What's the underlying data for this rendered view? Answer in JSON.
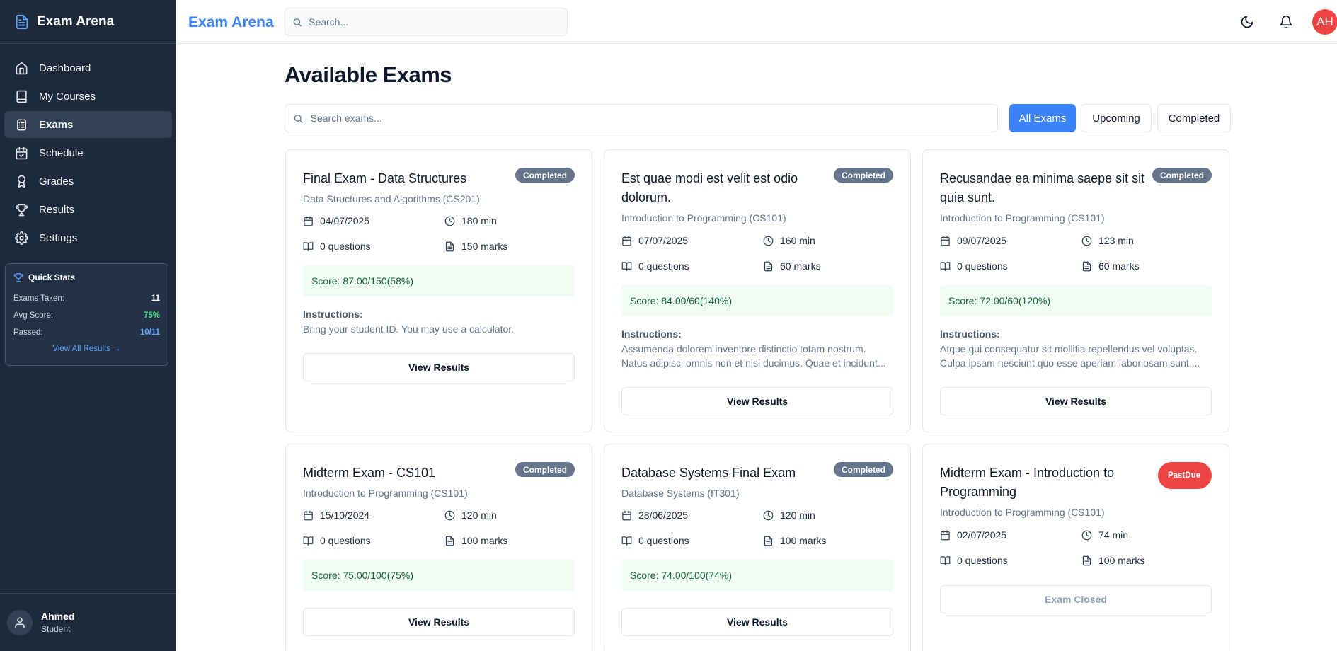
{
  "app": {
    "title": "Exam Arena"
  },
  "sidebar": {
    "items": [
      {
        "label": "Dashboard",
        "icon": "home-icon"
      },
      {
        "label": "My Courses",
        "icon": "book-icon"
      },
      {
        "label": "Exams",
        "icon": "clipboard-icon",
        "active": true
      },
      {
        "label": "Schedule",
        "icon": "calendar-check-icon"
      },
      {
        "label": "Grades",
        "icon": "award-icon"
      },
      {
        "label": "Results",
        "icon": "trophy-icon"
      },
      {
        "label": "Settings",
        "icon": "gear-icon"
      }
    ],
    "quick_stats": {
      "title": "Quick Stats",
      "exams_taken_label": "Exams Taken:",
      "exams_taken": "11",
      "avg_score_label": "Avg Score:",
      "avg_score": "75%",
      "passed_label": "Passed:",
      "passed": "10/11",
      "link": "View All Results →"
    },
    "user": {
      "name": "Ahmed",
      "role": "Student"
    }
  },
  "header": {
    "brand": "Exam Arena",
    "search_placeholder": "Search...",
    "avatar_initials": "AH"
  },
  "main": {
    "title": "Available Exams",
    "search_placeholder": "Search exams...",
    "filters": [
      "All Exams",
      "Upcoming",
      "Completed"
    ],
    "instructions_label": "Instructions:",
    "exams": [
      {
        "title": "Final Exam - Data Structures",
        "status": "Completed",
        "course": "Data Structures and Algorithms (CS201)",
        "date": "04/07/2025",
        "duration": "180 min",
        "questions": "0 questions",
        "marks": "150 marks",
        "score": "Score: 87.00/150(58%)",
        "instructions": "Bring your student ID. You may use a calculator.",
        "button": "View Results"
      },
      {
        "title": "Est quae modi est velit est odio dolorum.",
        "status": "Completed",
        "course": "Introduction to Programming (CS101)",
        "date": "07/07/2025",
        "duration": "160 min",
        "questions": "0 questions",
        "marks": "60 marks",
        "score": "Score: 84.00/60(140%)",
        "instructions_line1": "Assumenda dolorem inventore distinctio totam nostrum.",
        "instructions_line2": "Natus adipisci omnis non et nisi ducimus. Quae et incidunt...",
        "button": "View Results"
      },
      {
        "title": "Recusandae ea minima saepe sit sit quia sunt.",
        "status": "Completed",
        "course": "Introduction to Programming (CS101)",
        "date": "09/07/2025",
        "duration": "123 min",
        "questions": "0 questions",
        "marks": "60 marks",
        "score": "Score: 72.00/60(120%)",
        "instructions_line1": "Atque qui consequatur sit mollitia repellendus vel voluptas.",
        "instructions_line2": "Culpa ipsam nesciunt quo esse aperiam laboriosam sunt....",
        "button": "View Results"
      },
      {
        "title": "Midterm Exam - CS101",
        "status": "Completed",
        "course": "Introduction to Programming (CS101)",
        "date": "15/10/2024",
        "duration": "120 min",
        "questions": "0 questions",
        "marks": "100 marks",
        "score": "Score: 75.00/100(75%)",
        "button": "View Results"
      },
      {
        "title": "Database Systems Final Exam",
        "status": "Completed",
        "course": "Database Systems (IT301)",
        "date": "28/06/2025",
        "duration": "120 min",
        "questions": "0 questions",
        "marks": "100 marks",
        "score": "Score: 74.00/100(74%)",
        "button": "View Results"
      },
      {
        "title": "Midterm Exam - Introduction to Programming",
        "status_line1": "Past",
        "status_line2": "Due",
        "course": "Introduction to Programming (CS101)",
        "date": "02/07/2025",
        "duration": "74 min",
        "questions": "0 questions",
        "marks": "100 marks",
        "button": "Exam Closed"
      }
    ]
  },
  "colors": {
    "sidebar_bg": "#1e293b",
    "accent": "#3b82f6",
    "completed_badge": "#64748b",
    "past_due_badge": "#ef4444",
    "score_bg": "#f0fdf4",
    "score_text": "#166534",
    "avatar_bg": "#ef4444"
  }
}
